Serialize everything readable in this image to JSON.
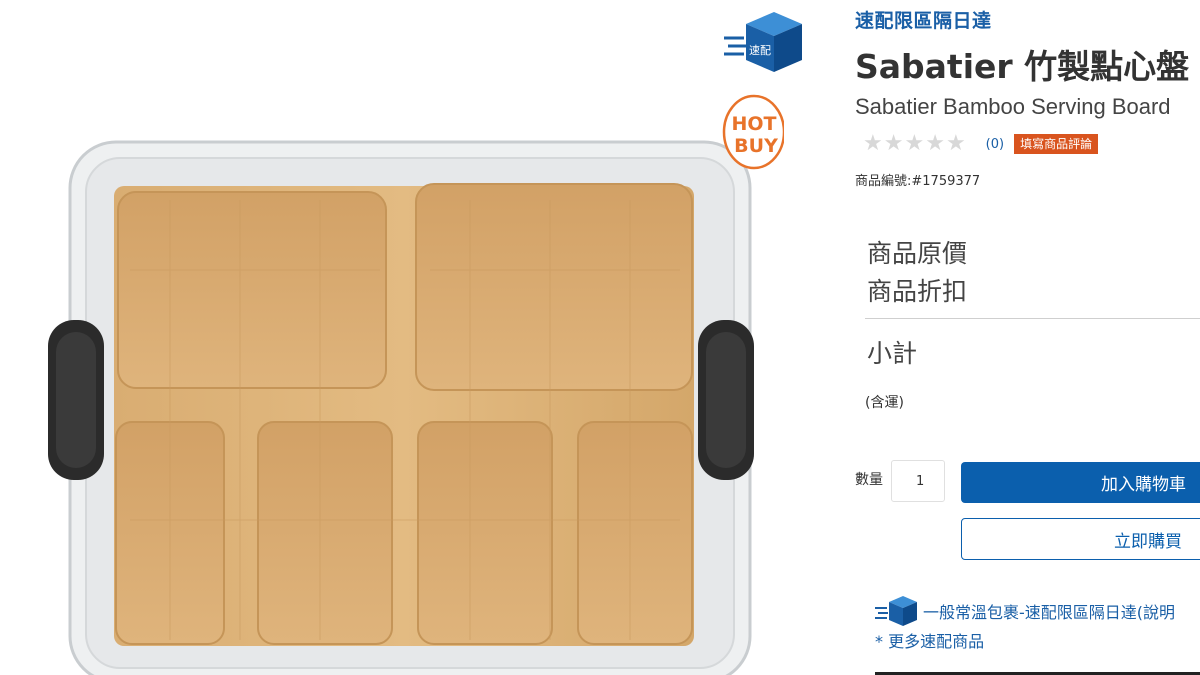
{
  "badges": {
    "speed_badge_text": "速配",
    "hot_buy_line1": "HOT",
    "hot_buy_line2": "BUY"
  },
  "product": {
    "delivery_tag": "速配限區隔日達",
    "title": "Sabatier 竹製點心盤",
    "subtitle": "Sabatier Bamboo Serving Board",
    "rating": {
      "stars_filled": 0,
      "stars_total": 5,
      "review_count": "(0)",
      "write_review_label": "填寫商品評論"
    },
    "item_number": "商品編號:#1759377"
  },
  "pricing": {
    "original_price_label": "商品原價",
    "discount_label": "商品折扣",
    "subtotal_label": "小計",
    "shipping_note": "(含運)"
  },
  "purchase": {
    "quantity_label": "數量",
    "quantity_value": "1",
    "add_to_cart_label": "加入購物車",
    "buy_now_label": "立即購買"
  },
  "delivery": {
    "info_text": "一般常溫包裹-速配限區隔日達(說明",
    "more_link": "* 更多速配商品"
  },
  "colors": {
    "brand_blue": "#0b5fad",
    "link_blue": "#1a5fa6",
    "review_orange": "#d9541e",
    "hot_buy_orange": "#e8732a"
  }
}
